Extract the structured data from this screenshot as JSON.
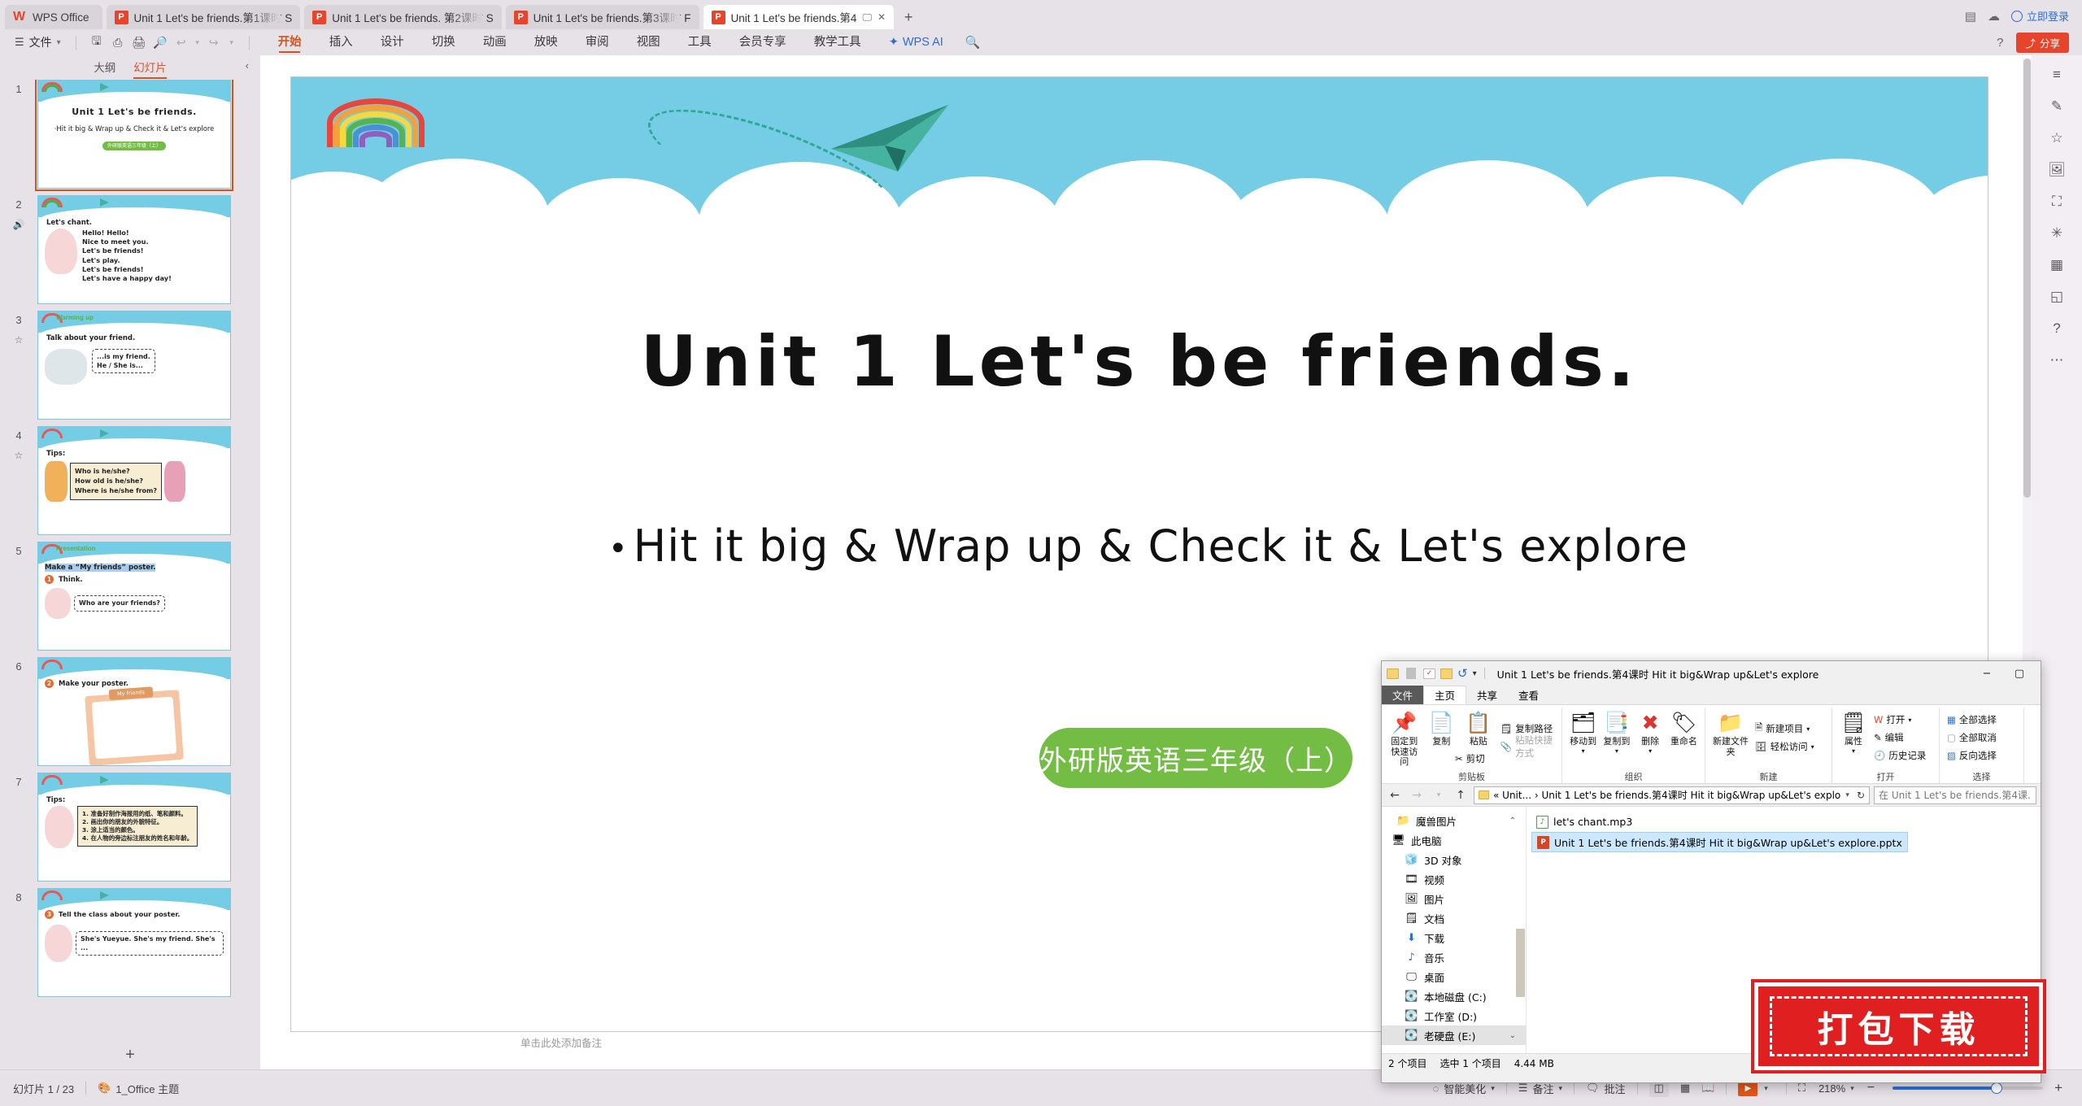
{
  "tabbar": {
    "home_label": "WPS Office",
    "tabs": [
      {
        "title": "Unit 1  Let's be friends.第1课时 S",
        "active": false
      },
      {
        "title": "Unit 1  Let's be friends. 第2课时 S",
        "active": false
      },
      {
        "title": "Unit 1  Let's be friends.第3课时 F",
        "active": false
      },
      {
        "title": "Unit 1  Let's be friends.第4",
        "active": true
      }
    ],
    "new_tab": "+",
    "right_icons": [
      "grid-icon",
      "cloud-icon"
    ],
    "login_label": "立即登录"
  },
  "ribbon": {
    "file_label": "文件",
    "quick_icons": [
      "save-icon",
      "print-preview-icon",
      "print-icon",
      "find-icon",
      "undo-icon",
      "redo-icon",
      "customize-icon"
    ],
    "tabs": [
      {
        "label": "开始",
        "active": true
      },
      {
        "label": "插入",
        "active": false
      },
      {
        "label": "设计",
        "active": false
      },
      {
        "label": "切换",
        "active": false
      },
      {
        "label": "动画",
        "active": false
      },
      {
        "label": "放映",
        "active": false
      },
      {
        "label": "审阅",
        "active": false
      },
      {
        "label": "视图",
        "active": false
      },
      {
        "label": "工具",
        "active": false
      },
      {
        "label": "会员专享",
        "active": false
      },
      {
        "label": "教学工具",
        "active": false
      },
      {
        "label": "WPS AI",
        "active": false
      }
    ],
    "search_icon": "search-icon",
    "share_label": "分享",
    "help_icon": "help-icon"
  },
  "left_panel": {
    "tab_outline": "大纲",
    "tab_slides": "幻灯片",
    "collapse_icon": "chevron-left-icon",
    "add_slide": "+",
    "slides": [
      {
        "num": "1",
        "selected": true,
        "kind": "title",
        "title": "Unit 1   Let's be friends.",
        "subtitle": "·Hit it big & Wrap up & Check it & Let's explore",
        "pill": "外研版英语三年级（上）"
      },
      {
        "num": "2",
        "selected": false,
        "kind": "chant",
        "heading": "Let's chant.",
        "badge": "sound-icon",
        "lines": [
          "Hello! Hello!",
          "Nice to meet you.",
          "Let's be friends!",
          "Let's play.",
          "Let's be friends!",
          "Let's have a happy day!"
        ]
      },
      {
        "num": "3",
        "selected": false,
        "kind": "warming",
        "tag": "Warming up",
        "badge": "star-icon",
        "heading": "Talk about your friend.",
        "bubble": "...is my friend.\nHe / She is..."
      },
      {
        "num": "4",
        "selected": false,
        "kind": "tips",
        "heading": "Tips:",
        "badge": "star-icon",
        "box": [
          "Who is he/she?",
          "How old is he/she?",
          "Where is he/she from?"
        ]
      },
      {
        "num": "5",
        "selected": false,
        "kind": "presentation",
        "tag": "Presentation",
        "heading": "Make a “My friends” poster.",
        "step": "Think.",
        "step_num": "1",
        "bubble": "Who are your friends?"
      },
      {
        "num": "6",
        "selected": false,
        "kind": "poster",
        "heading": "Make your poster.",
        "step_num": "2",
        "poster_tag": "My friends"
      },
      {
        "num": "7",
        "selected": false,
        "kind": "tips-cn",
        "heading": "Tips:",
        "box": [
          "1. 准备好制作海报用的纸、笔和颜料。",
          "2. 画出你的朋友的外貌特征。",
          "3. 涂上适当的颜色。",
          "4. 在人物的旁边标注朋友的姓名和年龄。"
        ]
      },
      {
        "num": "8",
        "selected": false,
        "kind": "tell",
        "heading": "Tell the class about your poster.",
        "step_num": "3",
        "bubble": "She's Yueyue. She's my friend. She's ..."
      }
    ]
  },
  "slide": {
    "title": "Unit 1   Let's be friends.",
    "bullet": "Hit it big & Wrap up & Check it & Let's explore",
    "bullet_dot": "•",
    "pill": "外研版英语三年级（上）",
    "notes_placeholder": "单击此处添加备注"
  },
  "right_toolbar": {
    "icons": [
      "layers-icon",
      "format-icon",
      "star-icon",
      "image-icon",
      "crop-icon",
      "effects-icon",
      "table-icon",
      "shape-icon",
      "help-icon",
      "more-icon"
    ]
  },
  "statusbar": {
    "slide_count": "幻灯片 1 / 23",
    "theme_icon": "theme-icon",
    "theme": "1_Office 主题",
    "beautify": "智能美化",
    "notes": "备注",
    "comments": "批注",
    "view_normal_icon": "normal-view-icon",
    "view_sorter_icon": "slide-sorter-icon",
    "view_reading_icon": "reading-view-icon",
    "play_icon": "play-icon",
    "fit_icon": "fit-to-window-icon",
    "zoom": "218%",
    "zoom_out": "−",
    "zoom_in": "+"
  },
  "explorer": {
    "title": "Unit 1  Let's be friends.第4课时 Hit it big&Wrap up&Let's explore",
    "qat": [
      "folder-icon",
      "properties-icon",
      "new-folder-icon",
      "undo-icon",
      "dropdown-icon"
    ],
    "minimize": "−",
    "maximize": "▢",
    "menus": [
      {
        "label": "文件",
        "style": "file"
      },
      {
        "label": "主页",
        "style": "sel"
      },
      {
        "label": "共享",
        "style": "normal"
      },
      {
        "label": "查看",
        "style": "normal"
      }
    ],
    "groups": [
      {
        "name": "剪贴板",
        "big": [
          {
            "icon": "pin-icon",
            "label": "固定到快速访问"
          },
          {
            "icon": "copy-icon",
            "label": "复制"
          },
          {
            "icon": "paste-icon",
            "label": "粘贴"
          }
        ],
        "small": [
          {
            "icon": "copy-path-icon",
            "label": "复制路径",
            "disabled": false
          },
          {
            "icon": "paste-shortcut-icon",
            "label": "粘贴快捷方式",
            "disabled": true
          },
          {
            "icon": "cut-icon",
            "label": "剪切",
            "disabled": false
          }
        ]
      },
      {
        "name": "组织",
        "big": [
          {
            "icon": "move-to-icon",
            "label": "移动到"
          },
          {
            "icon": "copy-to-icon",
            "label": "复制到"
          },
          {
            "icon": "delete-icon",
            "label": "删除"
          },
          {
            "icon": "rename-icon",
            "label": "重命名"
          }
        ],
        "small": []
      },
      {
        "name": "新建",
        "big": [
          {
            "icon": "new-folder-icon",
            "label": "新建文件夹"
          }
        ],
        "small": [
          {
            "icon": "new-item-icon",
            "label": "新建项目",
            "disabled": false
          },
          {
            "icon": "easy-access-icon",
            "label": "轻松访问",
            "disabled": false
          }
        ]
      },
      {
        "name": "打开",
        "big": [
          {
            "icon": "properties-icon",
            "label": "属性"
          }
        ],
        "small": [
          {
            "icon": "open-with-icon",
            "label": "打开",
            "disabled": false
          },
          {
            "icon": "edit-icon",
            "label": "编辑",
            "disabled": false
          },
          {
            "icon": "history-icon",
            "label": "历史记录",
            "disabled": false
          }
        ]
      },
      {
        "name": "选择",
        "big": [],
        "small": [
          {
            "icon": "select-all-icon",
            "label": "全部选择",
            "disabled": false
          },
          {
            "icon": "select-none-icon",
            "label": "全部取消",
            "disabled": false
          },
          {
            "icon": "invert-selection-icon",
            "label": "反向选择",
            "disabled": false
          }
        ]
      }
    ],
    "address": "« Unit...  ›  Unit 1  Let's be friends.第4课时 Hit it big&Wrap up&Let's explore",
    "search_placeholder": "在 Unit 1  Let's be friends.第4课...",
    "tree": [
      {
        "icon": "folder-icon",
        "label": "魔兽图片",
        "selected": false
      },
      {
        "icon": "this-pc-icon",
        "label": "此电脑",
        "selected": false
      },
      {
        "icon": "3d-objects-icon",
        "label": "3D 对象",
        "selected": false
      },
      {
        "icon": "videos-icon",
        "label": "视频",
        "selected": false
      },
      {
        "icon": "pictures-icon",
        "label": "图片",
        "selected": false
      },
      {
        "icon": "documents-icon",
        "label": "文档",
        "selected": false
      },
      {
        "icon": "downloads-icon",
        "label": "下载",
        "selected": false
      },
      {
        "icon": "music-icon",
        "label": "音乐",
        "selected": false
      },
      {
        "icon": "desktop-icon",
        "label": "桌面",
        "selected": false
      },
      {
        "icon": "drive-icon",
        "label": "本地磁盘 (C:)",
        "selected": false
      },
      {
        "icon": "drive-icon",
        "label": "工作室 (D:)",
        "selected": false
      },
      {
        "icon": "drive-icon",
        "label": "老硬盘 (E:)",
        "selected": true
      }
    ],
    "files": [
      {
        "icon": "mp3-icon",
        "name": "let's chant.mp3",
        "selected": false
      },
      {
        "icon": "pptx-icon",
        "name": "Unit 1  Let's be friends.第4课时  Hit it big&Wrap up&Let's explore.pptx",
        "selected": true
      }
    ],
    "status_count": "2 个项目",
    "status_selected": "选中 1 个项目",
    "status_size": "4.44 MB"
  },
  "stamp": {
    "text": "打包下载"
  }
}
